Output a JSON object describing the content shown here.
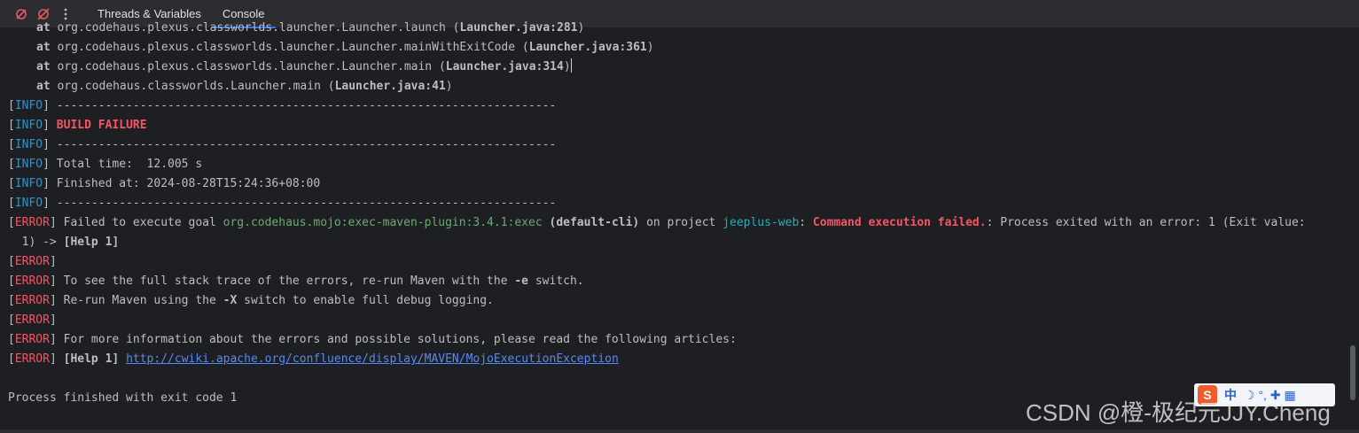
{
  "toolbar": {
    "icons": [
      "mute-breakpoints-icon",
      "clear-breakpoints-icon",
      "more-options-icon"
    ],
    "tabs": [
      {
        "label": "Threads & Variables",
        "active": false
      },
      {
        "label": "Console",
        "active": true
      }
    ]
  },
  "console": {
    "stack": [
      {
        "prefix": "at",
        "text": " org.codehaus.plexus.classworlds.launcher.Launcher.launch (",
        "file": "Launcher.java:281",
        "end": ")"
      },
      {
        "prefix": "at",
        "text": " org.codehaus.plexus.classworlds.launcher.Launcher.mainWithExitCode (",
        "file": "Launcher.java:361",
        "end": ")"
      },
      {
        "prefix": "at",
        "text": " org.codehaus.plexus.classworlds.launcher.Launcher.main (",
        "file": "Launcher.java:314",
        "end": ")"
      },
      {
        "prefix": "at",
        "text": " org.codehaus.classworlds.Launcher.main (",
        "file": "Launcher.java:41",
        "end": ")"
      }
    ],
    "tags": {
      "info_open": "[",
      "info": "INFO",
      "info_close": "]",
      "error": "ERROR"
    },
    "separator": " ------------------------------------------------------------------------",
    "build_failure": "BUILD FAILURE",
    "total_time": " Total time:  12.005 s",
    "finished_at": " Finished at: 2024-08-28T15:24:36+08:00",
    "error_goal": {
      "a": " Failed to execute goal ",
      "plugin": "org.codehaus.mojo:exec-maven-plugin:3.4.1:exec",
      "b": " ",
      "cli": "(default-cli)",
      "c": " on project ",
      "project": "jeeplus-web",
      "d": ": ",
      "failed": "Command execution failed.",
      "e": ": Process exited with an error: 1 (Exit value:",
      "wrap": "  1) -> ",
      "help": "[Help 1]"
    },
    "see_trace": {
      "a": " To see the full stack trace of the errors, re-run Maven with the ",
      "flag": "-e",
      "b": " switch."
    },
    "rerun": {
      "a": " Re-run Maven using the ",
      "flag": "-X",
      "b": " switch to enable full debug logging."
    },
    "more_info": " For more information about the errors and possible solutions, please read the following articles:",
    "help_link": {
      "label": "[Help 1]",
      "url": "http://cwiki.apache.org/confluence/display/MAVEN/MojoExecutionException"
    },
    "process_finished": "Process finished with exit code 1"
  },
  "watermark": "CSDN @橙-极纪元JJY.Cheng",
  "ime": {
    "logo": "S",
    "lang": "中",
    "glyphs": "☽ °, ✚ ▦"
  },
  "colors": {
    "info": "#3592c4",
    "error": "#f75464",
    "plugin": "#6aab73",
    "project": "#2aacb8",
    "link": "#548af7"
  }
}
